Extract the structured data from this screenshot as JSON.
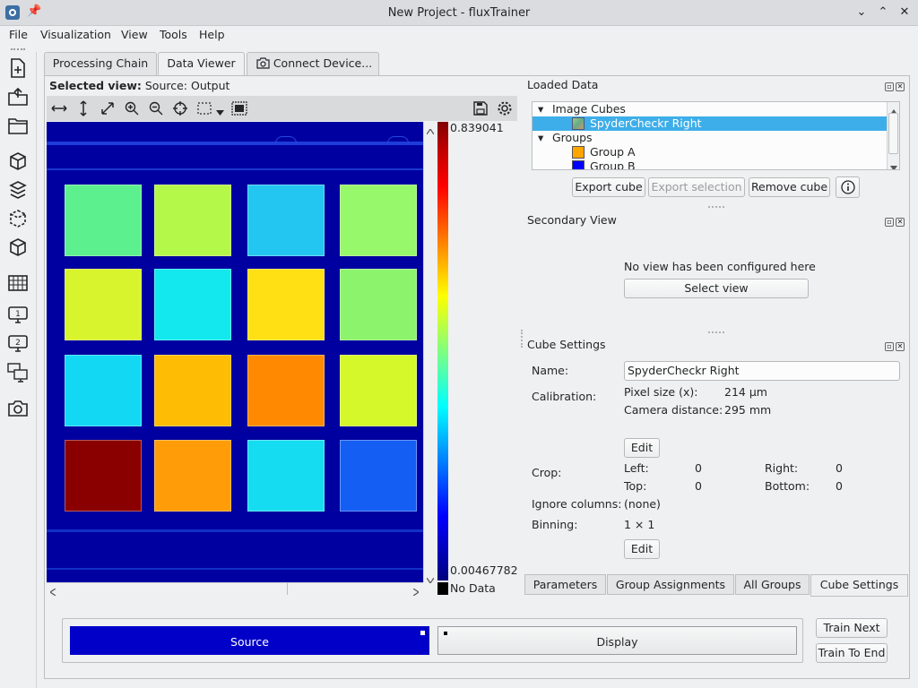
{
  "window": {
    "title": "New Project - fluxTrainer"
  },
  "menu": [
    "File",
    "Visualization",
    "View",
    "Tools",
    "Help"
  ],
  "tabs": {
    "processing_chain": "Processing Chain",
    "data_viewer": "Data Viewer",
    "connect_device": "Connect Device..."
  },
  "viewer": {
    "selected_label": "Selected view:",
    "selected_value": "Source: Output",
    "colorbar_max": "0.839041",
    "colorbar_min": "0.00467782",
    "no_data": "No Data",
    "grid": [
      [
        "#5cf08f",
        "#b4f84a",
        "#22c6f0",
        "#96f86a"
      ],
      [
        "#d8f42c",
        "#12e8ee",
        "#ffe014",
        "#8cf46c"
      ],
      [
        "#12d8f4",
        "#ffbc04",
        "#ff8a02",
        "#d4f82a"
      ],
      [
        "#8a0000",
        "#ff9c08",
        "#16dcf2",
        "#145ef4"
      ]
    ]
  },
  "loaded_data": {
    "title": "Loaded Data",
    "tree": {
      "image_cubes": "Image Cubes",
      "cube_name": "SpyderCheckr Right",
      "groups": "Groups",
      "group_a": "Group A",
      "group_b": "Group B"
    },
    "group_a_color": "#ffa500",
    "group_b_color": "#0000ff",
    "buttons": {
      "export_cube": "Export cube",
      "export_selection": "Export selection",
      "remove_cube": "Remove cube"
    }
  },
  "secondary_view": {
    "title": "Secondary View",
    "message": "No view has been configured here",
    "select_button": "Select view"
  },
  "cube_settings": {
    "title": "Cube Settings",
    "name_label": "Name:",
    "name_value": "SpyderCheckr Right",
    "calibration_label": "Calibration:",
    "pixel_size_label": "Pixel size (x):",
    "pixel_size_value": "214 µm",
    "camera_distance_label": "Camera distance:",
    "camera_distance_value": "295 mm",
    "edit_label": "Edit",
    "crop_label": "Crop:",
    "left_label": "Left:",
    "left_value": "0",
    "right_label": "Right:",
    "right_value": "0",
    "top_label": "Top:",
    "top_value": "0",
    "bottom_label": "Bottom:",
    "bottom_value": "0",
    "ignore_label": "Ignore columns:",
    "ignore_value": "(none)",
    "binning_label": "Binning:",
    "binning_value": "1 × 1"
  },
  "bottom_tabs": [
    "Parameters",
    "Group Assignments",
    "All Groups",
    "Cube Settings"
  ],
  "chain": {
    "source": "Source",
    "display": "Display",
    "source_color": "#0000c8"
  },
  "train": {
    "next": "Train Next",
    "to_end": "Train To End"
  }
}
